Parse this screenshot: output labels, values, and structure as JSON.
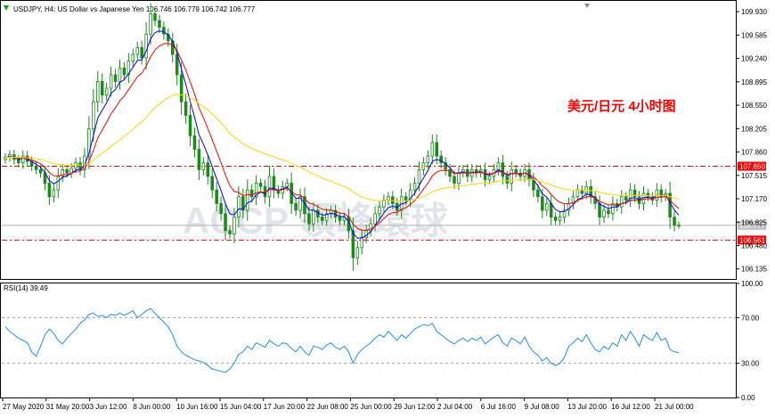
{
  "header": {
    "symbol_info": "USDJPY, H4:  US Dollar vs Japanese Yen  106.746 106.779 106.742 106.777"
  },
  "annotation": {
    "text": "美元/日元  4小时图",
    "color": "#ff0000"
  },
  "watermark": {
    "text": "ACCP 領峰環球"
  },
  "colors": {
    "bull_candle": "#1a8a1a",
    "bear_candle": "#1a8a1a",
    "ma_fast": "#0000ff",
    "ma_mid": "#ff0000",
    "ma_slow": "#ffd700",
    "rsi_line": "#1e90ff",
    "hline": "#ff0000"
  },
  "chart_data": [
    {
      "type": "candlestick",
      "title": "USDJPY, H4",
      "y_ticks": [
        "109.930",
        "109.585",
        "109.240",
        "108.895",
        "108.550",
        "108.205",
        "107.860",
        "107.515",
        "107.170",
        "106.825",
        "106.480",
        "106.135"
      ],
      "ylim": [
        106.0,
        110.05
      ],
      "x_ticks": [
        "27 May 2020",
        "31 May 20:00",
        "3 Jun 12:00",
        "8 Jun 00:00",
        "10 Jun 16:00",
        "15 Jun 04:00",
        "17 Jun 20:00",
        "22 Jun 08:00",
        "25 Jun 00:00",
        "29 Jun 12:00",
        "2 Jul 04:00",
        "6 Jul 16:00",
        "9 Jul 08:00",
        "13 Jul 20:00",
        "16 Jul 12:00",
        "21 Jul 00:00"
      ],
      "current_price_label": "106.777",
      "horizontal_lines": [
        {
          "label": "107.650",
          "value": 107.65
        },
        {
          "label": "106.561",
          "value": 106.561
        }
      ],
      "closes": [
        107.78,
        107.82,
        107.75,
        107.7,
        107.8,
        107.72,
        107.65,
        107.6,
        107.55,
        107.4,
        107.2,
        107.3,
        107.5,
        107.6,
        107.55,
        107.62,
        107.7,
        107.6,
        107.8,
        108.2,
        108.6,
        108.9,
        108.7,
        108.8,
        109.0,
        108.9,
        109.1,
        109.0,
        109.2,
        109.3,
        109.4,
        109.25,
        109.6,
        109.9,
        109.8,
        109.7,
        109.6,
        109.5,
        109.3,
        109.0,
        108.6,
        108.4,
        108.1,
        107.9,
        107.6,
        107.7,
        107.5,
        107.3,
        107.1,
        106.95,
        106.7,
        106.65,
        106.9,
        107.2,
        107.0,
        107.3,
        107.2,
        107.4,
        107.35,
        107.2,
        107.5,
        107.3,
        107.25,
        107.35,
        107.4,
        107.1,
        107.0,
        107.2,
        106.95,
        106.8,
        107.0,
        106.9,
        106.85,
        106.95,
        107.0,
        106.9,
        106.85,
        106.9,
        106.7,
        106.3,
        106.45,
        106.6,
        106.7,
        106.8,
        106.95,
        107.05,
        107.15,
        107.2,
        107.1,
        107.0,
        107.2,
        107.15,
        107.3,
        107.4,
        107.6,
        107.7,
        107.8,
        108.0,
        107.8,
        107.7,
        107.6,
        107.5,
        107.4,
        107.55,
        107.6,
        107.5,
        107.6,
        107.55,
        107.6,
        107.45,
        107.5,
        107.6,
        107.7,
        107.5,
        107.4,
        107.6,
        107.55,
        107.5,
        107.6,
        107.45,
        107.3,
        107.2,
        107.0,
        107.1,
        106.9,
        106.85,
        106.9,
        107.0,
        107.1,
        107.2,
        107.3,
        107.25,
        107.35,
        107.2,
        107.1,
        106.9,
        107.0,
        106.95,
        107.1,
        107.05,
        107.2,
        107.15,
        107.3,
        107.2,
        107.1,
        107.25,
        107.2,
        107.15,
        107.3,
        107.2,
        107.25,
        106.9,
        106.78,
        106.777
      ]
    },
    {
      "type": "line",
      "title": "RSI(14) 39.49",
      "y_ticks": [
        "100.00",
        "70.00",
        "30.00",
        "0.00"
      ],
      "ylim": [
        0,
        100
      ],
      "levels": [
        70,
        30
      ],
      "series": [
        {
          "values": [
            62,
            58,
            55,
            52,
            50,
            48,
            40,
            36,
            45,
            55,
            60,
            56,
            50,
            47,
            52,
            56,
            60,
            65,
            68,
            73,
            74,
            71,
            72,
            70,
            73,
            72,
            74,
            72,
            74,
            76,
            70,
            73,
            76,
            78,
            74,
            70,
            66,
            62,
            55,
            45,
            40,
            37,
            35,
            33,
            32,
            31,
            28,
            25,
            24,
            23,
            22,
            25,
            30,
            38,
            40,
            45,
            42,
            48,
            46,
            44,
            50,
            47,
            45,
            48,
            47,
            43,
            40,
            45,
            40,
            37,
            45,
            44,
            42,
            46,
            48,
            44,
            42,
            45,
            40,
            30,
            38,
            42,
            45,
            48,
            52,
            55,
            53,
            58,
            54,
            50,
            55,
            52,
            56,
            60,
            62,
            64,
            63,
            65,
            58,
            55,
            52,
            49,
            47,
            50,
            52,
            49,
            52,
            50,
            53,
            47,
            50,
            53,
            55,
            48,
            45,
            52,
            50,
            47,
            53,
            45,
            40,
            37,
            32,
            35,
            30,
            28,
            30,
            35,
            45,
            48,
            52,
            49,
            55,
            48,
            42,
            40,
            45,
            42,
            48,
            45,
            55,
            50,
            58,
            52,
            45,
            55,
            52,
            50,
            57,
            50,
            52,
            42,
            40,
            39.49
          ]
        }
      ]
    }
  ]
}
